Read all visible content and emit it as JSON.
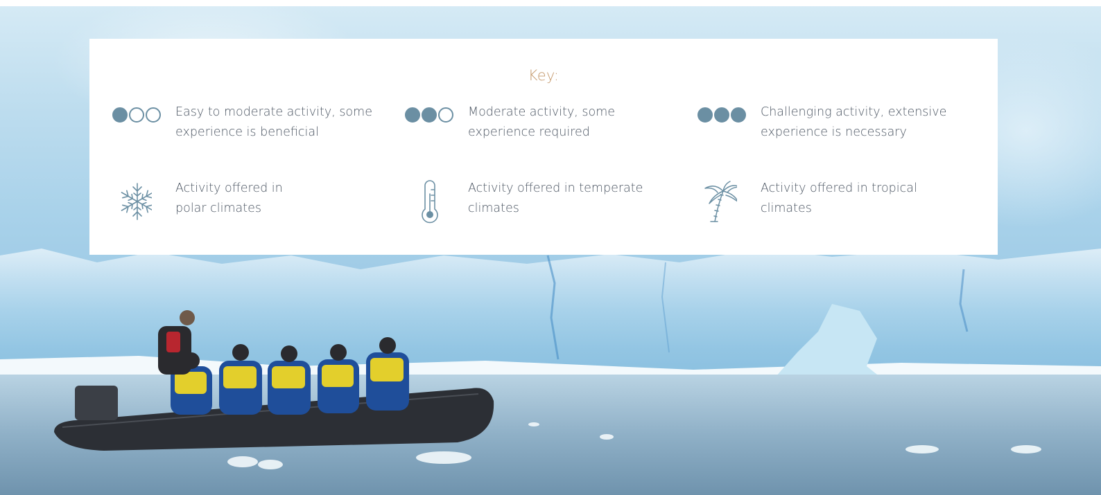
{
  "key": {
    "title": "Key:",
    "difficulty": [
      {
        "level": 1,
        "of": 3,
        "icon": "one-of-three-dots-icon",
        "text": "Easy to moderate activity, some experience is beneficial"
      },
      {
        "level": 2,
        "of": 3,
        "icon": "two-of-three-dots-icon",
        "text": "Moderate activity, some experience required"
      },
      {
        "level": 3,
        "of": 3,
        "icon": "three-of-three-dots-icon",
        "text": "Challenging activity, extensive experience is necessary"
      }
    ],
    "climates": [
      {
        "icon": "snowflake-icon",
        "text": "Activity offered in polar climates"
      },
      {
        "icon": "thermometer-icon",
        "text": "Activity offered in temperate climates"
      },
      {
        "icon": "palm-tree-icon",
        "text": "Activity offered in tropical climates"
      }
    ]
  },
  "colors": {
    "icon": "#6b8fa3",
    "title": "#c59a6e",
    "text": "#4c5663",
    "card": "#ffffff"
  },
  "background": {
    "description_icon": "glacier-zodiac-photo"
  }
}
